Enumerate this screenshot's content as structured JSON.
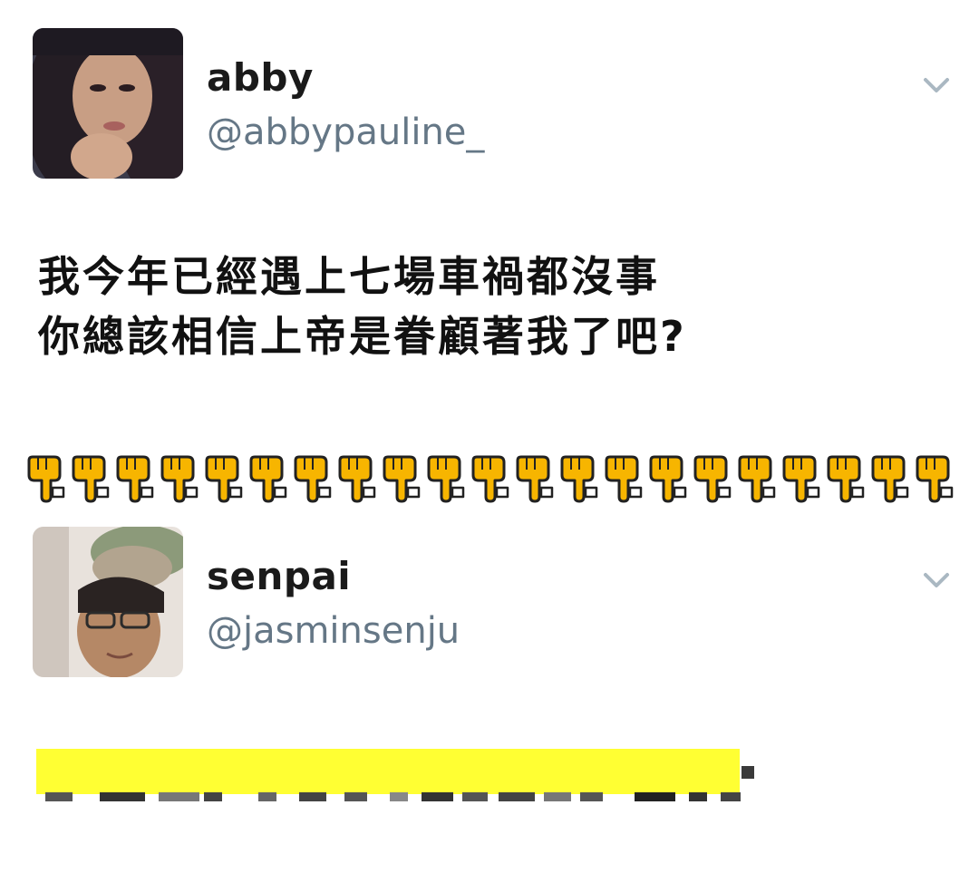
{
  "tweets": [
    {
      "display_name": "abby",
      "handle": "@abbypauline_",
      "avatar_icon": "avatar-photo-icon",
      "menu_icon": "chevron-down-icon",
      "text_lines": [
        "我今年已經遇上七場車禍都沒事",
        "你總該相信上帝是眷顧著我了吧?"
      ]
    },
    {
      "display_name": "senpai",
      "handle": "@jasminsenju",
      "avatar_icon": "avatar-photo-icon",
      "menu_icon": "chevron-down-icon"
    }
  ],
  "separator": {
    "icon": "pointing-down-hand-icon",
    "count": 21,
    "color": "#f7b500"
  },
  "reply_censor": {
    "highlight_color": "#ffff33"
  },
  "colors": {
    "handle": "#657786",
    "chevron": "#aab8c2"
  }
}
